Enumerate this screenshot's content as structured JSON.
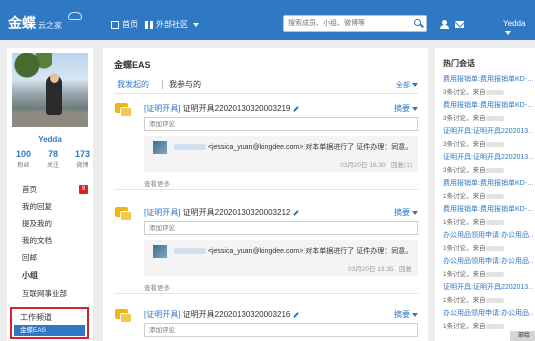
{
  "header": {
    "logo": "金蝶",
    "logo_sub": "云之家",
    "home": "首页",
    "external": "外部社区",
    "search_placeholder": "搜索成员、小组、微博等",
    "username": "Yedda"
  },
  "sidebar": {
    "name": "Yedda",
    "stats": [
      {
        "value": "100",
        "label": "粉丝"
      },
      {
        "value": "78",
        "label": "关注"
      },
      {
        "value": "173",
        "label": "微博"
      }
    ],
    "menu": [
      {
        "label": "首页",
        "badge": "9"
      },
      {
        "label": "我的回复"
      },
      {
        "label": "提及我的"
      },
      {
        "label": "我的文档"
      },
      {
        "label": "回邮"
      }
    ],
    "group_title": "小组",
    "group_item": "互联网事业部",
    "channel_title": "工作频道",
    "channel_active": "金蝶EAS"
  },
  "main": {
    "title": "金蝶EAS",
    "tabs": [
      "我发起的",
      "我参与的"
    ],
    "filter": "全部",
    "posts": [
      {
        "tag": "[证明开具]",
        "number": "证明开具220201303200032",
        "number_tail": "19",
        "summary": "摘要",
        "comment_placeholder": "添加评论",
        "reply_user": "<jessica_yuan@kingdee.com>",
        "reply_text": "对本单据进行了 证件办理：同意。",
        "reply_time": "03月20日 16:30",
        "reply_action": "回复(1)",
        "view_more": "查看更多"
      },
      {
        "tag": "[证明开具]",
        "number": "证明开具220201303200032",
        "number_tail": "12",
        "summary": "摘要",
        "comment_placeholder": "添加评论",
        "reply_user": "<jessica_yuan@kingdee.com>",
        "reply_text": "对本单据进行了 证件办理：同意。",
        "reply_time": "03月20日 13:35",
        "reply_action": "回复",
        "view_more": "查看更多"
      },
      {
        "tag": "[证明开具]",
        "number": "证明开具220201303200032",
        "number_tail": "16",
        "summary": "摘要",
        "comment_placeholder": "添加评论"
      }
    ]
  },
  "right": {
    "title": "热门会话",
    "topics": [
      {
        "title": "费用报销单:费用报销单KD-…",
        "meta": "3条讨论，来自"
      },
      {
        "title": "费用报销单:费用报销单KD-…",
        "meta": "3条讨论，来自"
      },
      {
        "title": "证明开具:证明开具2202013…",
        "meta": "3条讨论，来自"
      },
      {
        "title": "证明开具:证明开具2202013…",
        "meta": "3条讨论，来自"
      },
      {
        "title": "费用报销单:费用报销单KD-…",
        "meta": "1条讨论，来自"
      },
      {
        "title": "费用报销单:费用报销单KD-…",
        "meta": "1条讨论，来自"
      },
      {
        "title": "办公用品领用申请:办公用品…",
        "meta": "1条讨论，来自"
      },
      {
        "title": "办公用品领用申请:办公用品…",
        "meta": "1条讨论，来自"
      },
      {
        "title": "证明开具:证明开具2202013…",
        "meta": "1条讨论，来自"
      },
      {
        "title": "办公用品领用申请:办公用品…",
        "meta": "1条讨论，来自"
      }
    ]
  },
  "corner": "部给"
}
